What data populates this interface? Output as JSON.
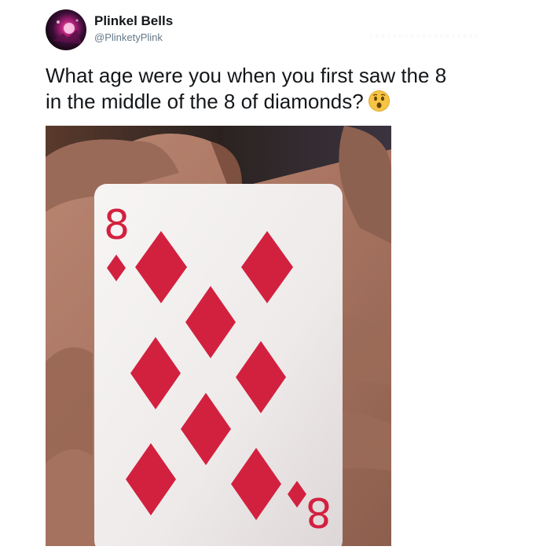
{
  "tweet": {
    "author": {
      "display_name": "Plinkel Bells",
      "handle": "@PlinketyPlink",
      "avatar_icon": "avatar-photo-icon"
    },
    "text_line1": "What age were you when you first saw the 8",
    "text_line2": "in the middle of the 8 of diamonds?",
    "emoji_icon": "surprised-face-icon",
    "photo": {
      "subject": "playing-card-eight-of-diamonds",
      "card_rank": "8",
      "suit_color": "#d2213f",
      "card_color": "#f7f5f4"
    }
  },
  "colors": {
    "text": "#14171a",
    "muted": "#657786",
    "emoji": "#f7c545"
  }
}
